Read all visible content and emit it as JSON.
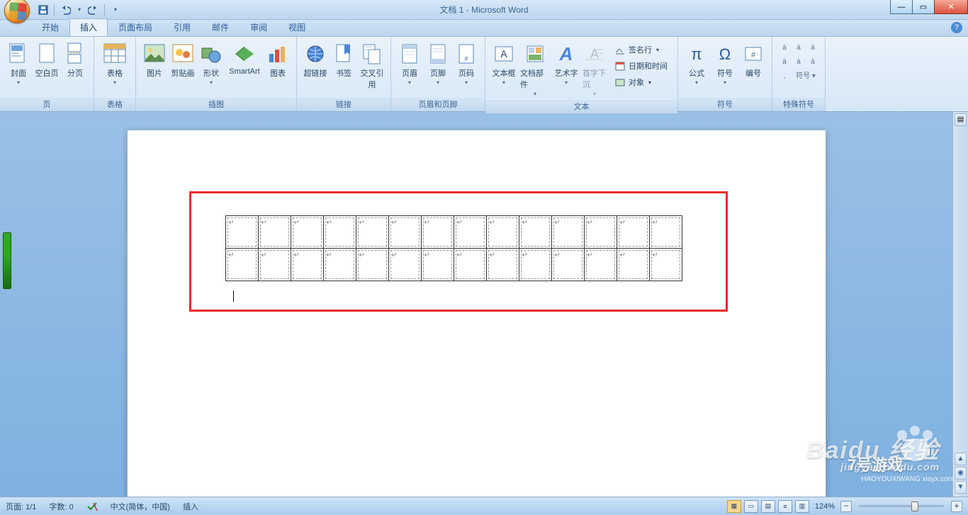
{
  "title": "文档 1 - Microsoft Word",
  "qat": {
    "save": "save-icon",
    "undo": "undo-icon",
    "redo": "redo-icon"
  },
  "tabs": [
    "开始",
    "插入",
    "页面布局",
    "引用",
    "邮件",
    "审阅",
    "视图"
  ],
  "active_tab_index": 1,
  "ribbon": {
    "groups": [
      {
        "label": "页",
        "items": [
          {
            "label": "封面",
            "icon": "cover-page-icon",
            "split": true
          },
          {
            "label": "空白页",
            "icon": "blank-page-icon"
          },
          {
            "label": "分页",
            "icon": "page-break-icon"
          }
        ]
      },
      {
        "label": "表格",
        "items": [
          {
            "label": "表格",
            "icon": "table-icon",
            "split": true
          }
        ]
      },
      {
        "label": "插图",
        "items": [
          {
            "label": "图片",
            "icon": "picture-icon"
          },
          {
            "label": "剪贴画",
            "icon": "clipart-icon"
          },
          {
            "label": "形状",
            "icon": "shapes-icon",
            "split": true
          },
          {
            "label": "SmartArt",
            "icon": "smartart-icon"
          },
          {
            "label": "图表",
            "icon": "chart-icon"
          }
        ]
      },
      {
        "label": "链接",
        "items": [
          {
            "label": "超链接",
            "icon": "hyperlink-icon"
          },
          {
            "label": "书签",
            "icon": "bookmark-icon"
          },
          {
            "label": "交叉引用",
            "icon": "crossref-icon"
          }
        ]
      },
      {
        "label": "页眉和页脚",
        "items": [
          {
            "label": "页眉",
            "icon": "header-icon",
            "split": true
          },
          {
            "label": "页脚",
            "icon": "footer-icon",
            "split": true
          },
          {
            "label": "页码",
            "icon": "pagenum-icon",
            "split": true
          }
        ]
      },
      {
        "label": "文本",
        "items": [
          {
            "label": "文本框",
            "icon": "textbox-icon",
            "split": true
          },
          {
            "label": "文档部件",
            "icon": "quickparts-icon",
            "split": true
          },
          {
            "label": "艺术字",
            "icon": "wordart-icon",
            "split": true
          },
          {
            "label": "首字下沉",
            "icon": "dropcap-icon",
            "split": true,
            "disabled": true
          }
        ],
        "stack": [
          {
            "label": "签名行",
            "icon": "signature-icon",
            "split": true
          },
          {
            "label": "日期和时间",
            "icon": "datetime-icon"
          },
          {
            "label": "对象",
            "icon": "object-icon",
            "split": true
          }
        ]
      },
      {
        "label": "符号",
        "items": [
          {
            "label": "公式",
            "icon": "equation-icon",
            "split": true
          },
          {
            "label": "符号",
            "icon": "symbol-icon",
            "split": true
          },
          {
            "label": "编号",
            "icon": "number-icon"
          }
        ]
      },
      {
        "label": "特殊符号",
        "special": [
          "à",
          "à",
          "à",
          "à",
          "à",
          "à",
          ",",
          "符号",
          "▾"
        ],
        "symbol_btn": "符号"
      }
    ]
  },
  "document": {
    "table": {
      "rows": 2,
      "cols": 14
    }
  },
  "status": {
    "page": "页面: 1/1",
    "words": "字数: 0",
    "lang": "中文(简体，中国)",
    "mode": "插入",
    "zoom": "124%"
  },
  "watermarks": {
    "baidu": "Baidu 经验",
    "baidu_sub": "jingyan.baidu.com",
    "game": "7号游戏",
    "game_sub": "HAOYOUXIWANG xiayx.com"
  }
}
